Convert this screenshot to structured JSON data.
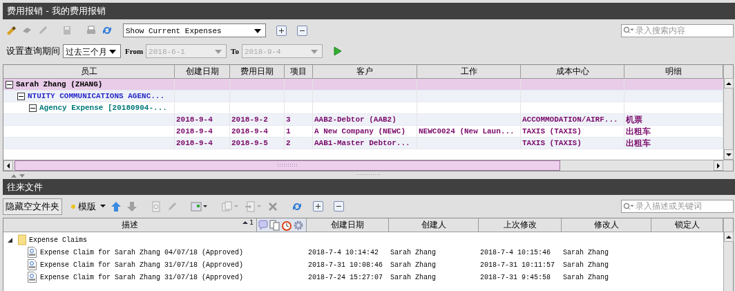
{
  "window": {
    "title": "费用报销 - 我的费用报销"
  },
  "toolbar": {
    "view": "Show Current Expenses",
    "search_placeholder": "录入搜索内容"
  },
  "period": {
    "label": "设置查询期间",
    "range": "过去三个月",
    "from_label": "From",
    "from": {
      "value": "2018-6-1",
      "disabled": true
    },
    "to_label": "To",
    "to": {
      "value": "2018-9-4",
      "disabled": true
    }
  },
  "expenses": {
    "columns": [
      "员工",
      "创建日期",
      "费用日期",
      "项目",
      "客户",
      "工作",
      "成本中心",
      "明细"
    ],
    "tree": [
      {
        "kind": "group",
        "label": "Sarah Zhang (ZHANG)",
        "expanded": true,
        "children": [
          {
            "kind": "group",
            "label": "NTUITY COMMUNICATIONS AGENC...",
            "expanded": true,
            "children": [
              {
                "kind": "group",
                "label": "Agency Expense [20180904-...",
                "expanded": true,
                "children": [
                  {
                    "kind": "entry",
                    "created": "2018-9-4",
                    "date": "2018-9-2",
                    "item": "3",
                    "customer": "AAB2-Debtor (AAB2)",
                    "cost_center": "ACCOMMODATION/AIRF...",
                    "detail": "机票"
                  },
                  {
                    "kind": "entry",
                    "created": "2018-9-4",
                    "date": "2018-9-4",
                    "item": "1",
                    "customer": "A New Company (NEWC)",
                    "job": "NEWC0024 (New Laun...",
                    "cost_center": "TAXIS (TAXIS)",
                    "detail": "出租车"
                  },
                  {
                    "kind": "entry",
                    "created": "2018-9-4",
                    "date": "2018-9-5",
                    "item": "2",
                    "customer": "AAB1-Master Debtor...",
                    "cost_center": "TAXIS (TAXIS)",
                    "detail": "出租车"
                  }
                ]
              }
            ]
          }
        ]
      }
    ]
  },
  "documents": {
    "title": "往来文件",
    "hide_empty_button": "隐藏空文件夹",
    "template_button": "模版",
    "search_placeholder": "录入描述或关键词",
    "columns": [
      {
        "label": "描述",
        "sort_rank": "1"
      },
      {
        "label": "创建日期"
      },
      {
        "label": "创建人"
      },
      {
        "label": "上次修改"
      },
      {
        "label": "修改人"
      },
      {
        "label": "锁定人"
      }
    ],
    "folders": [
      {
        "label": "Expense Claims",
        "expanded": true,
        "children": [
          {
            "description": "Expense Claim for Sarah Zhang 04/07/18 (Approved)",
            "created": "2018-7-4 10:14:42",
            "creator": "Sarah Zhang",
            "modified": "2018-7-4 10:15:46",
            "modifier": "Sarah Zhang"
          },
          {
            "description": "Expense Claim for Sarah Zhang 31/07/18 (Approved)",
            "created": "2018-7-31 10:08:46",
            "creator": "Sarah Zhang",
            "modified": "2018-7-31 10:11:57",
            "modifier": "Sarah Zhang"
          },
          {
            "description": "Expense Claim for Sarah Zhang 31/07/18 (Approved)",
            "created": "2018-7-24 15:27:07",
            "creator": "Sarah Zhang",
            "modified": "2018-7-31 9:45:58",
            "modifier": "Sarah Zhang"
          }
        ]
      }
    ]
  }
}
